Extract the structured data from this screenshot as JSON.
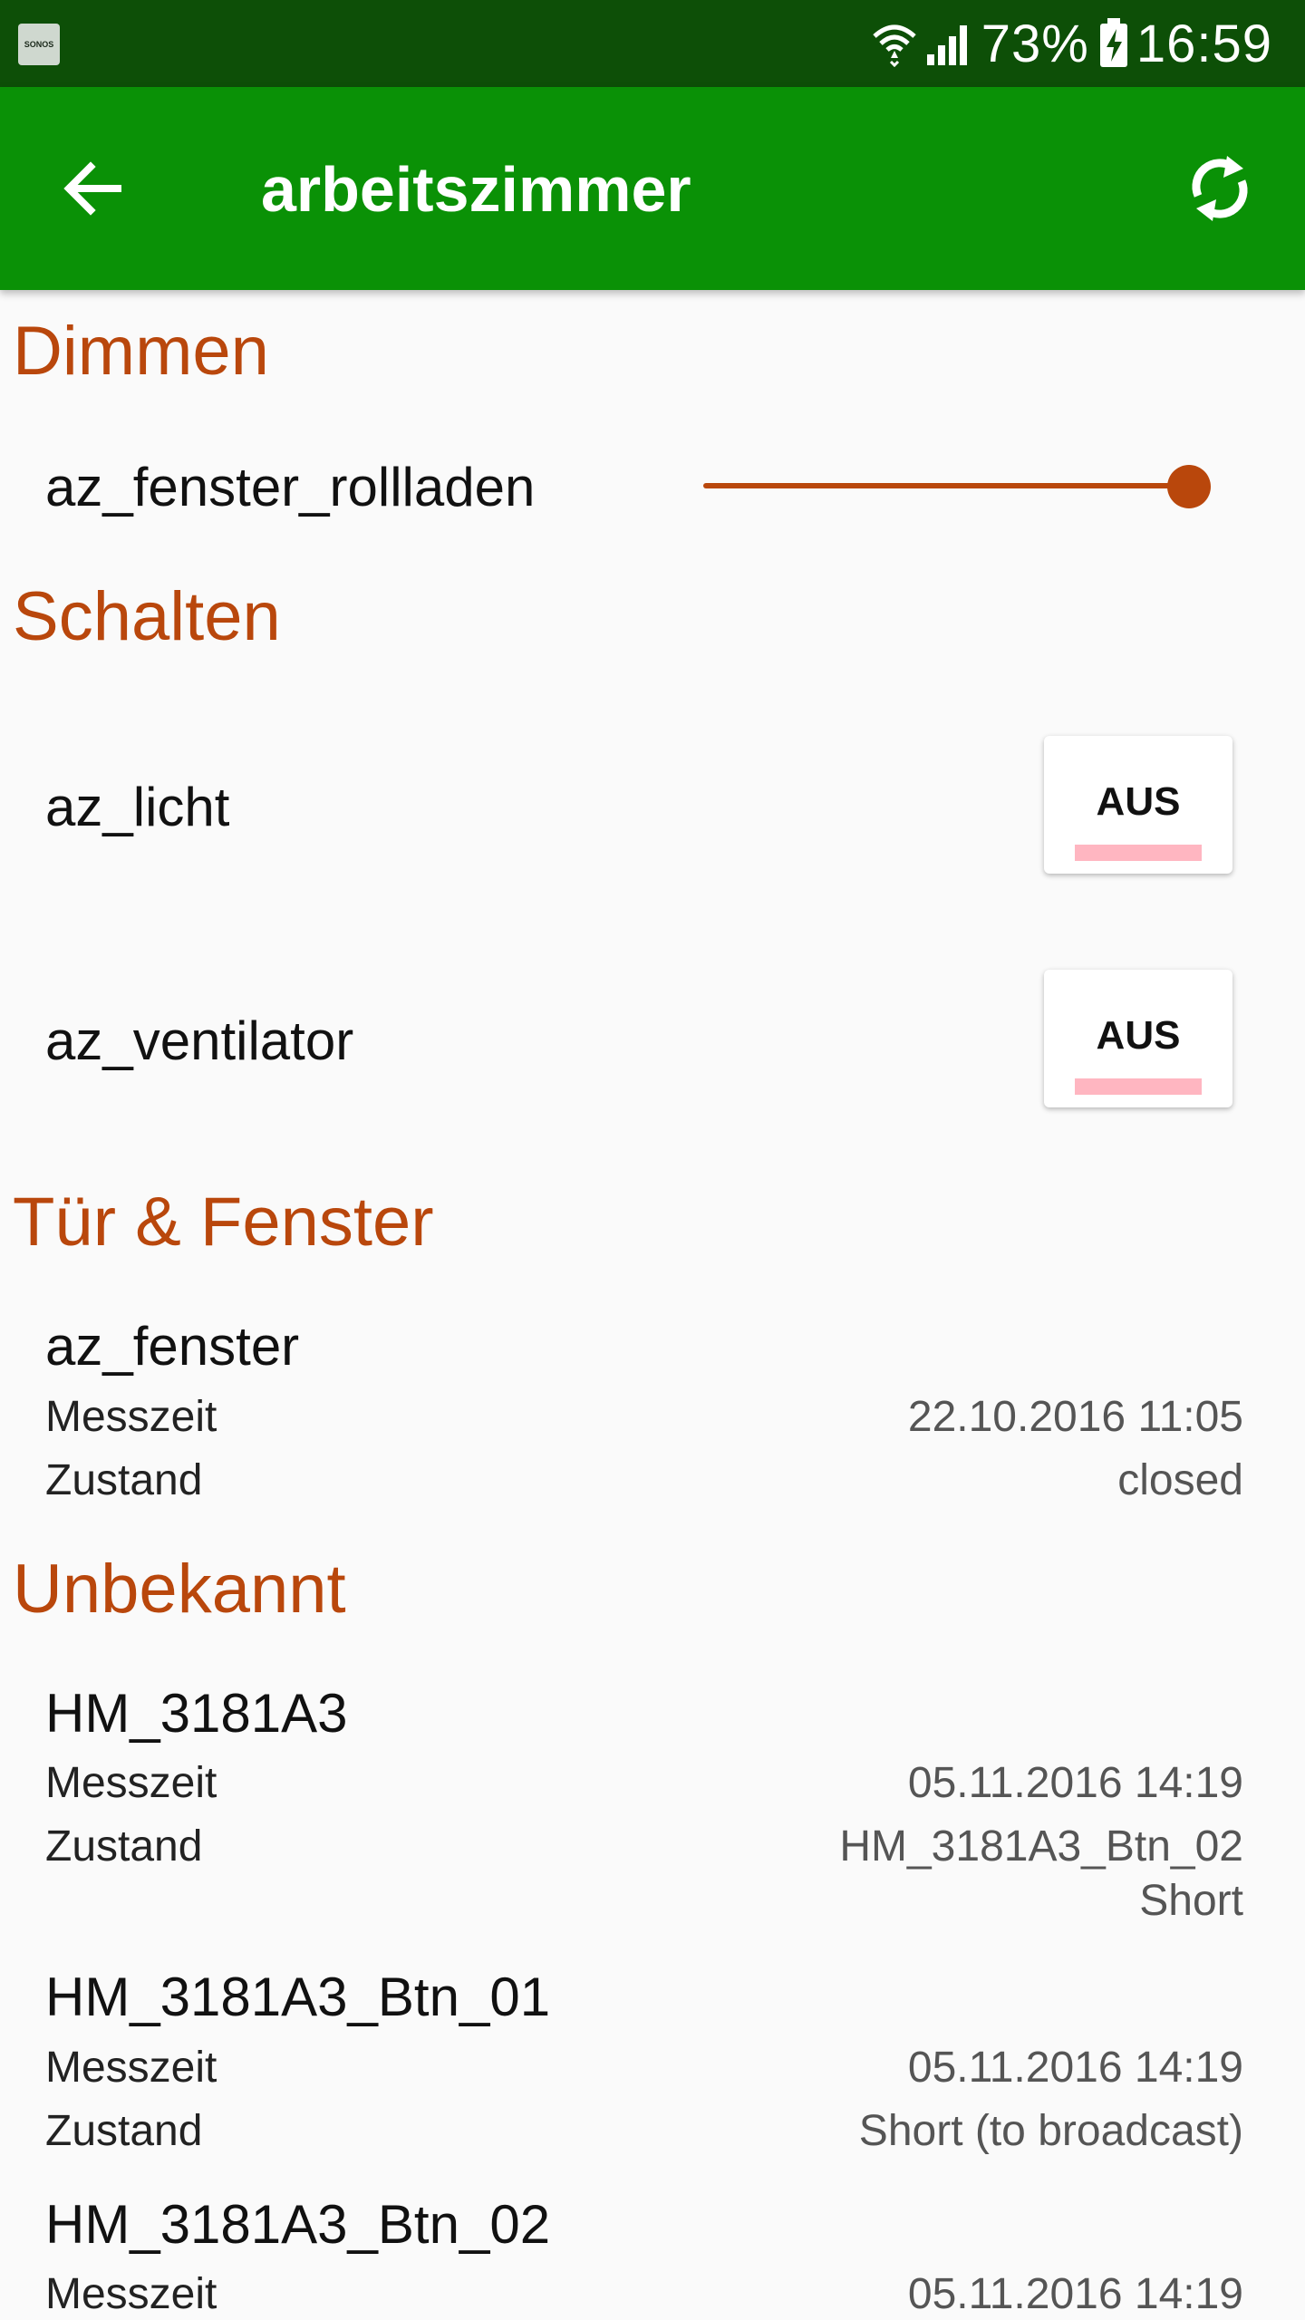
{
  "status_bar": {
    "app_badge": "SONOS",
    "battery_percent": "73%",
    "time": "16:59",
    "icons": [
      "wifi-icon",
      "signal-icon",
      "battery-charging-icon"
    ]
  },
  "app_bar": {
    "title": "arbeitszimmer",
    "back_icon": "arrow-back-icon",
    "refresh_icon": "refresh-icon"
  },
  "colors": {
    "status_bar": "#0d4f07",
    "app_bar": "#0a9106",
    "accent": "#b9470c",
    "toggle_indicator": "#ffb6c1"
  },
  "sections": {
    "dimmen": {
      "title": "Dimmen",
      "items": [
        {
          "label": "az_fenster_rollladen",
          "slider_value": 1.0
        }
      ]
    },
    "schalten": {
      "title": "Schalten",
      "items": [
        {
          "label": "az_licht",
          "toggle": "AUS"
        },
        {
          "label": "az_ventilator",
          "toggle": "AUS"
        }
      ]
    },
    "tuer_fenster": {
      "title": "Tür & Fenster",
      "items": [
        {
          "label": "az_fenster",
          "messzeit_label": "Messzeit",
          "messzeit": "22.10.2016 11:05",
          "zustand_label": "Zustand",
          "zustand": "closed"
        }
      ]
    },
    "unbekannt": {
      "title": "Unbekannt",
      "items": [
        {
          "label": "HM_3181A3",
          "messzeit_label": "Messzeit",
          "messzeit": "05.11.2016 14:19",
          "zustand_label": "Zustand",
          "zustand_line1": "HM_3181A3_Btn_02",
          "zustand_line2": "Short"
        },
        {
          "label": "HM_3181A3_Btn_01",
          "messzeit_label": "Messzeit",
          "messzeit": "05.11.2016 14:19",
          "zustand_label": "Zustand",
          "zustand": "Short (to broadcast)"
        },
        {
          "label": "HM_3181A3_Btn_02",
          "messzeit_label": "Messzeit",
          "messzeit": "05.11.2016 14:19"
        }
      ]
    }
  }
}
